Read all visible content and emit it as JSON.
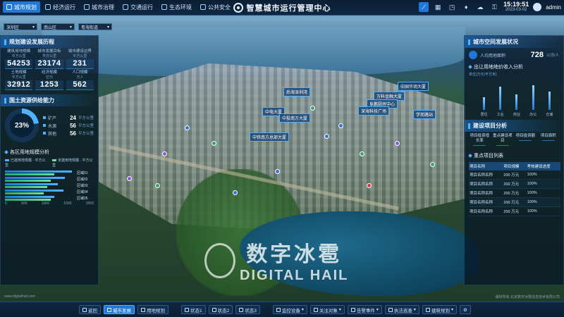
{
  "topbar": {
    "tabs": [
      {
        "label": "城市规划",
        "active": true,
        "icon": "city-plan-icon"
      },
      {
        "label": "经济运行",
        "active": false,
        "icon": "economy-icon"
      },
      {
        "label": "城市治理",
        "active": false,
        "icon": "governance-icon"
      },
      {
        "label": "交通运行",
        "active": false,
        "icon": "traffic-icon"
      },
      {
        "label": "生态环境",
        "active": false,
        "icon": "ecology-icon"
      },
      {
        "label": "公共安全",
        "active": false,
        "icon": "safety-icon"
      }
    ],
    "title": "智慧城市运行管理中心",
    "time": "15:19:51",
    "date": "2023-03-02",
    "user": "admin"
  },
  "selectors": [
    "深圳区",
    "南山区",
    "粤海街道"
  ],
  "left": {
    "planning": {
      "title": "规划建设发展历程",
      "stats": [
        {
          "label": "建筑用地规模",
          "unit": "平方公里",
          "value": "54253"
        },
        {
          "label": "城市发展目标",
          "unit": "平方公里",
          "value": "23174"
        },
        {
          "label": "城市建设边界",
          "unit": "平方公里",
          "value": "231"
        },
        {
          "label": "土地规模",
          "unit": "平方公里",
          "value": "32912"
        },
        {
          "label": "经济规模",
          "unit": "亿元",
          "value": "1253"
        },
        {
          "label": "人口规模",
          "unit": "万人",
          "value": "562"
        }
      ]
    },
    "supply": {
      "title": "国土资源供给能力",
      "percent": "23%",
      "percent_value": 23,
      "rows": [
        {
          "label": "矿产",
          "value": "24",
          "unit": "平方公里"
        },
        {
          "label": "水源",
          "value": "56",
          "unit": "平方公里"
        },
        {
          "label": "其他",
          "value": "56",
          "unit": "平方公里"
        }
      ]
    },
    "district": {
      "title": "各区用地规模分析",
      "legend": [
        "已建用地规模 · 平方公里",
        "未建用地规模 · 平方公里"
      ],
      "items": [
        {
          "label": "区域01",
          "a": 1900,
          "b": 1400
        },
        {
          "label": "区域02",
          "a": 1700,
          "b": 1300
        },
        {
          "label": "区域03",
          "a": 1500,
          "b": 1200
        },
        {
          "label": "区域04",
          "a": 1650,
          "b": 1100
        },
        {
          "label": "区域05",
          "a": 1400,
          "b": 1300
        }
      ],
      "axis": [
        "0",
        "500",
        "1000",
        "1500",
        "2000"
      ],
      "max": 2000
    }
  },
  "right": {
    "spatial": {
      "title": "城市空间发展状况",
      "area_label": "人均用地面积",
      "area_value": "728",
      "area_unit": "公顷/人"
    },
    "income": {
      "title": "出让用地地价收入分析",
      "ylabel": "单位(万元/平方米)",
      "categories": [
        "居住",
        "工业",
        "商业",
        "办公",
        "仓储"
      ],
      "values": [
        40,
        75,
        50,
        80,
        60
      ],
      "max": 100
    },
    "project": {
      "title": "建设项目分析",
      "cells": [
        "项目投资增长率",
        "重点建设项目",
        "项目投资额",
        "项目面积"
      ]
    },
    "table": {
      "title": "重点项目列表",
      "headers": [
        "项目名称",
        "项目规模",
        "考核建设进度"
      ],
      "rows": [
        [
          "项目名称名称",
          "200 万元",
          "100%"
        ],
        [
          "项目名称名称",
          "200 万元",
          "100%"
        ],
        [
          "项目名称名称",
          "200 万元",
          "100%"
        ],
        [
          "项目名称名称",
          "200 万元",
          "100%"
        ],
        [
          "项目名称名称",
          "200 万元",
          "100%"
        ]
      ]
    }
  },
  "map_labels": [
    "后海深圳湾",
    "中国华润大厦",
    "万科金融大厦",
    "阜鹏厨房中心",
    "深海科技广场",
    "中电大厦",
    "中投南方大厦",
    "学苑路站",
    "中铁南方总部大厦",
    "南山区"
  ],
  "watermark": {
    "cn": "数字冰雹",
    "en": "DIGITAL HAIL",
    "url": "www.digitalhail.com",
    "copyright": "版权所有 北京数字冰雹信息技术有限公司"
  },
  "bottombar": {
    "items": [
      {
        "label": "返回",
        "active": false
      },
      {
        "label": "城市发展",
        "active": true
      },
      {
        "label": "用地规划",
        "active": false
      },
      {
        "label": "状态1",
        "active": false
      },
      {
        "label": "状态2",
        "active": false
      },
      {
        "label": "状态3",
        "active": false
      },
      {
        "label": "监控设备",
        "active": false
      },
      {
        "label": "关注对象",
        "active": false
      },
      {
        "label": "告警事件",
        "active": false
      },
      {
        "label": "执法巡查",
        "active": false
      },
      {
        "label": "建筑规划",
        "active": false
      }
    ]
  },
  "colors": {
    "accent": "#1f78d8",
    "accent_light": "#4fb2ff",
    "bar_green": "#2ea86a"
  }
}
